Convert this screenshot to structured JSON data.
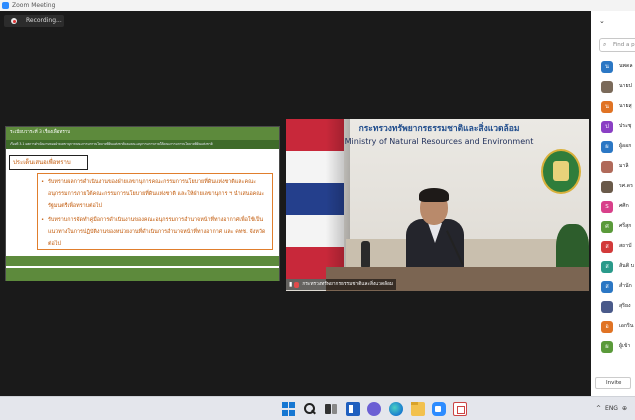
{
  "window": {
    "title": "Zoom Meeting"
  },
  "recording": {
    "label": "Recording..."
  },
  "slide": {
    "agenda_title": "ระเบียบวาระที่ 3 เรื่องเพื่อทราบ",
    "sub_title": "เรื่องที่ 3.1 ผลการดำเนินงานของฝ่ายเลขานุการคณะกรรมการนโยบายที่ดินแห่งชาติและคณะอนุกรรมการภายใต้คณะกรรมการนโยบายที่ดินแห่งชาติ",
    "box_title": "ประเด็นเสนอเพื่อทราบ",
    "items": [
      "รับทราบผลการดำเนินงานของฝ่ายเลขานุการคณะกรรมการนโยบายที่ดินแห่งชาติและคณะอนุกรรมการภายใต้คณะกรรมการนโยบายที่ดินแห่งชาติ และให้ฝ่ายเลขานุการ ฯ นำเสนอคณะรัฐมนตรีเพื่อทราบต่อไป",
      "รับทราบการจัดทำคู่มือการดำเนินงานของคณะอนุกรรมการอำนาจหน้าที่ทางอากาศเพื่อใช้เป็นแนวทางในการปฏิบัติงานของหน่วยงานที่ดำเนินการอำนาจหน้าที่ทางอากาศ และ คทช. จังหวัด ต่อไป"
    ]
  },
  "camera": {
    "heading_th": "กระทรวงทรัพยากรธรรมชาติและสิ่งแวดล้อม",
    "heading_en": "Ministry of Natural Resources and Environment",
    "participant_name": "กระทรวงทรัพยากรธรรมชาติและสิ่งแวดล้อม"
  },
  "panel": {
    "search_placeholder": "Find a p",
    "invite_label": "Invite",
    "participants": [
      {
        "initial": "น",
        "color": "#2b77c4",
        "name": "นพดล"
      },
      {
        "initial": "",
        "color": "#7a6a5a",
        "name": "นายป"
      },
      {
        "initial": "น",
        "color": "#e07324",
        "name": "นายสุ"
      },
      {
        "initial": "ป",
        "color": "#8a3fc4",
        "name": "ประชุ"
      },
      {
        "initial": "ผ",
        "color": "#2b77c4",
        "name": "ผู้ออก"
      },
      {
        "initial": "",
        "color": "#b06a5a",
        "name": "มาลิ"
      },
      {
        "initial": "",
        "color": "#6a5a4a",
        "name": "รศ.ดร"
      },
      {
        "initial": "S",
        "color": "#d8408a",
        "name": "ศศิก"
      },
      {
        "initial": "ศ",
        "color": "#5a9a3a",
        "name": "ศรีสุก"
      },
      {
        "initial": "ส",
        "color": "#d23a3a",
        "name": "สถาบั"
      },
      {
        "initial": "ส",
        "color": "#2a9a8a",
        "name": "สันติ บ"
      },
      {
        "initial": "ส",
        "color": "#2b77c4",
        "name": "สำนัก"
      },
      {
        "initial": "",
        "color": "#4a5a8a",
        "name": "สุริยง"
      },
      {
        "initial": "อ",
        "color": "#e07324",
        "name": "เอกริน"
      },
      {
        "initial": "ผ",
        "color": "#5a9a3a",
        "name": "ผู้เข้า"
      }
    ]
  },
  "taskbar": {
    "icons": [
      "windows-start-icon",
      "search-icon",
      "task-view-icon",
      "widgets-icon",
      "chat-icon",
      "edge-icon",
      "file-explorer-icon",
      "zoom-icon",
      "snipping-tool-icon"
    ],
    "tray": [
      "^",
      "ENG",
      "⊕"
    ]
  }
}
